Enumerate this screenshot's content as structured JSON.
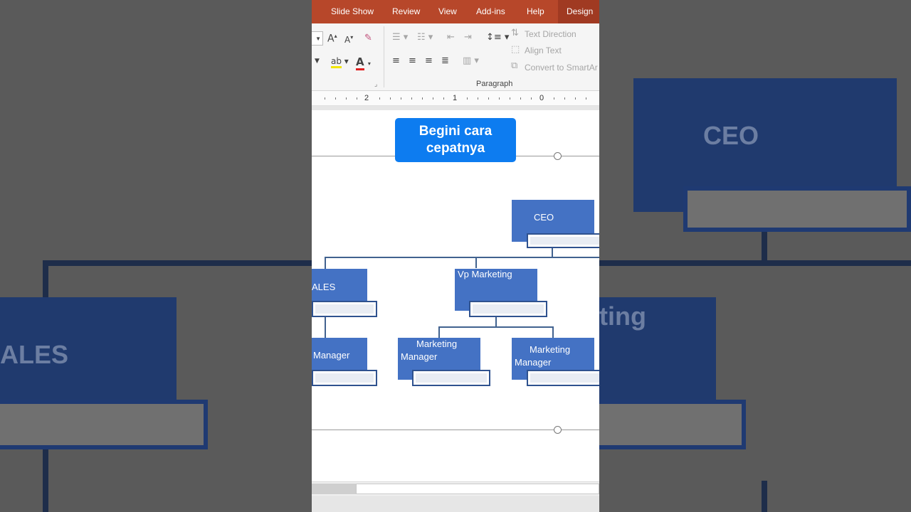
{
  "ribbon": {
    "tabs": [
      "Slide Show",
      "Review",
      "View",
      "Add-ins",
      "Help",
      "Design"
    ],
    "active_tab": "Design",
    "paragraph": {
      "text_direction": "Text Direction",
      "align_text": "Align Text",
      "convert_smartart": "Convert to SmartAr",
      "group_label": "Paragraph"
    }
  },
  "ruler": {
    "labels": [
      "2",
      "1",
      "0"
    ]
  },
  "overlay": {
    "line1": "Begini cara",
    "line2": "cepatnya"
  },
  "org_chart": {
    "ceo": "CEO",
    "vp_sales_partial": "ALES",
    "vp_marketing": "Vp Marketing",
    "sales_manager_partial": "Manager",
    "marketing_manager_1": [
      "Marketing",
      "Manager"
    ],
    "marketing_manager_2": [
      "Marketing",
      "Manager"
    ]
  },
  "background": {
    "ceo": "CEO",
    "sales": "ALES",
    "marketing": "ting"
  },
  "colors": {
    "ribbon": "#b7472a",
    "node": "#4472c4",
    "accent": "#0d7cf0"
  }
}
